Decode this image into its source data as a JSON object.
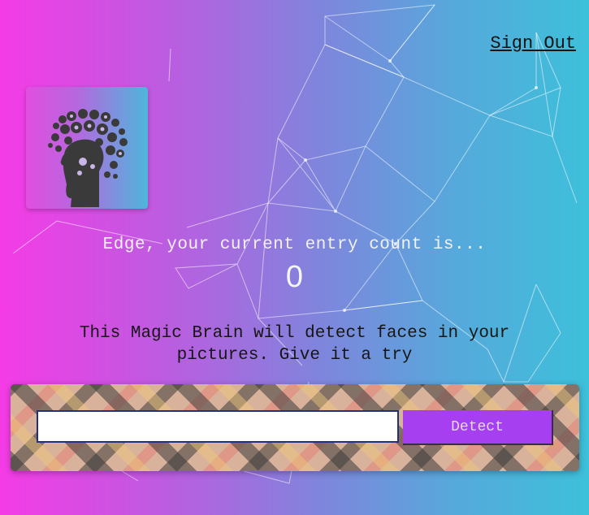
{
  "header": {
    "sign_out_label": "Sign Out"
  },
  "logo": {
    "icon": "brain-head-icon"
  },
  "rank": {
    "message": "Edge, your current entry count is...",
    "count": "0"
  },
  "description": {
    "line1": "This Magic Brain will detect faces in your",
    "line2": "pictures. Give it a try"
  },
  "form": {
    "input_value": "",
    "input_placeholder": "",
    "detect_label": "Detect"
  },
  "colors": {
    "gradient_left": "#f53be6",
    "gradient_right": "#3dc0da",
    "detect_button": "#a53ff0"
  }
}
